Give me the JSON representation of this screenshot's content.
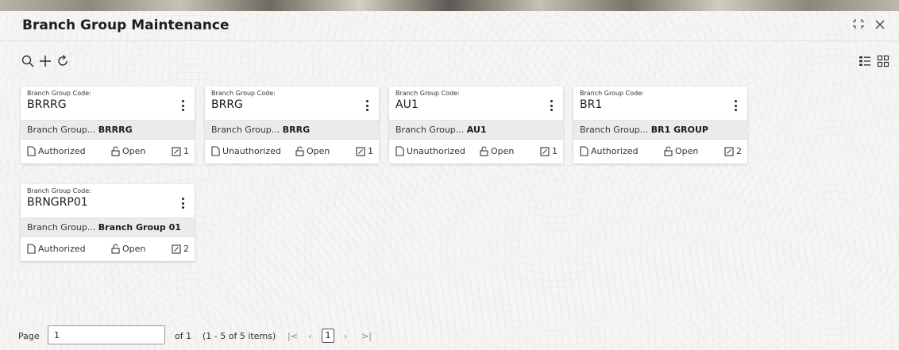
{
  "window": {
    "title": "Branch Group Maintenance"
  },
  "toolbar": {
    "icons": [
      "search-icon",
      "add-icon",
      "refresh-icon",
      "list-view-icon",
      "grid-view-icon"
    ]
  },
  "cards": [
    {
      "label": "Branch Group Code:",
      "code": "BRRRG",
      "desc_label": "Branch Group...",
      "desc_value": "BRRRG",
      "auth_status": "Authorized",
      "record_status": "Open",
      "mod_count": "1"
    },
    {
      "label": "Branch Group Code:",
      "code": "BRRG",
      "desc_label": "Branch Group...",
      "desc_value": "BRRG",
      "auth_status": "Unauthorized",
      "record_status": "Open",
      "mod_count": "1"
    },
    {
      "label": "Branch Group Code:",
      "code": "AU1",
      "desc_label": "Branch Group...",
      "desc_value": "AU1",
      "auth_status": "Unauthorized",
      "record_status": "Open",
      "mod_count": "1"
    },
    {
      "label": "Branch Group Code:",
      "code": "BR1",
      "desc_label": "Branch Group...",
      "desc_value": "BR1 GROUP",
      "auth_status": "Authorized",
      "record_status": "Open",
      "mod_count": "2"
    },
    {
      "label": "Branch Group Code:",
      "code": "BRNGRP01",
      "desc_label": "Branch Group...",
      "desc_value": "Branch Group 01",
      "auth_status": "Authorized",
      "record_status": "Open",
      "mod_count": "2"
    }
  ],
  "pagination": {
    "page_label": "Page",
    "page_value": "1",
    "of_text": "of 1",
    "items_text": "(1 - 5 of 5 items)",
    "first": "|<",
    "prev": "‹",
    "current": "1",
    "next": "›",
    "last": ">|"
  },
  "colors": {
    "accent_dark": "#1d1d1d",
    "card_bg": "#ffffff",
    "desc_bg": "#ecebea"
  }
}
